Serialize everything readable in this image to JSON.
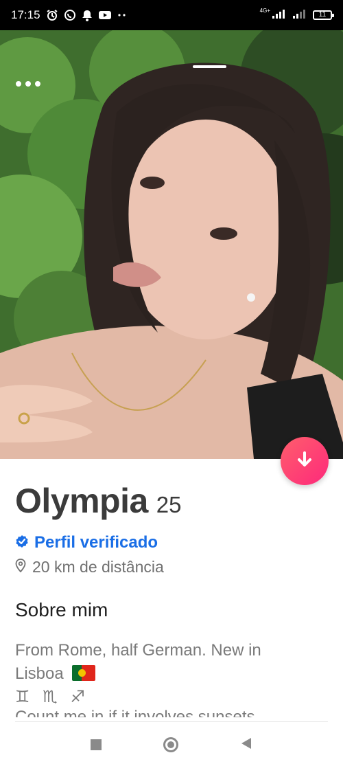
{
  "status_bar": {
    "time": "17:15",
    "network_label": "4G+",
    "battery_level": "11",
    "icons": [
      "alarm-icon",
      "whatsapp-icon",
      "notification-icon",
      "youtube-icon",
      "more-icon"
    ]
  },
  "photo": {
    "subject": "profile-photo"
  },
  "profile": {
    "name": "Olympia",
    "age": "25",
    "verified_label": "Perfil verificado",
    "distance": "20 km de distância"
  },
  "about": {
    "title": "Sobre mim",
    "bio_line1": "From Rome, half German. New in",
    "bio_line2": "Lisboa",
    "zodiac": "♊ ♏ ♐",
    "bio_line3": "Count me in if it involves sunsets"
  },
  "colors": {
    "accent": "#fd297b",
    "verified": "#1a6ee6"
  }
}
